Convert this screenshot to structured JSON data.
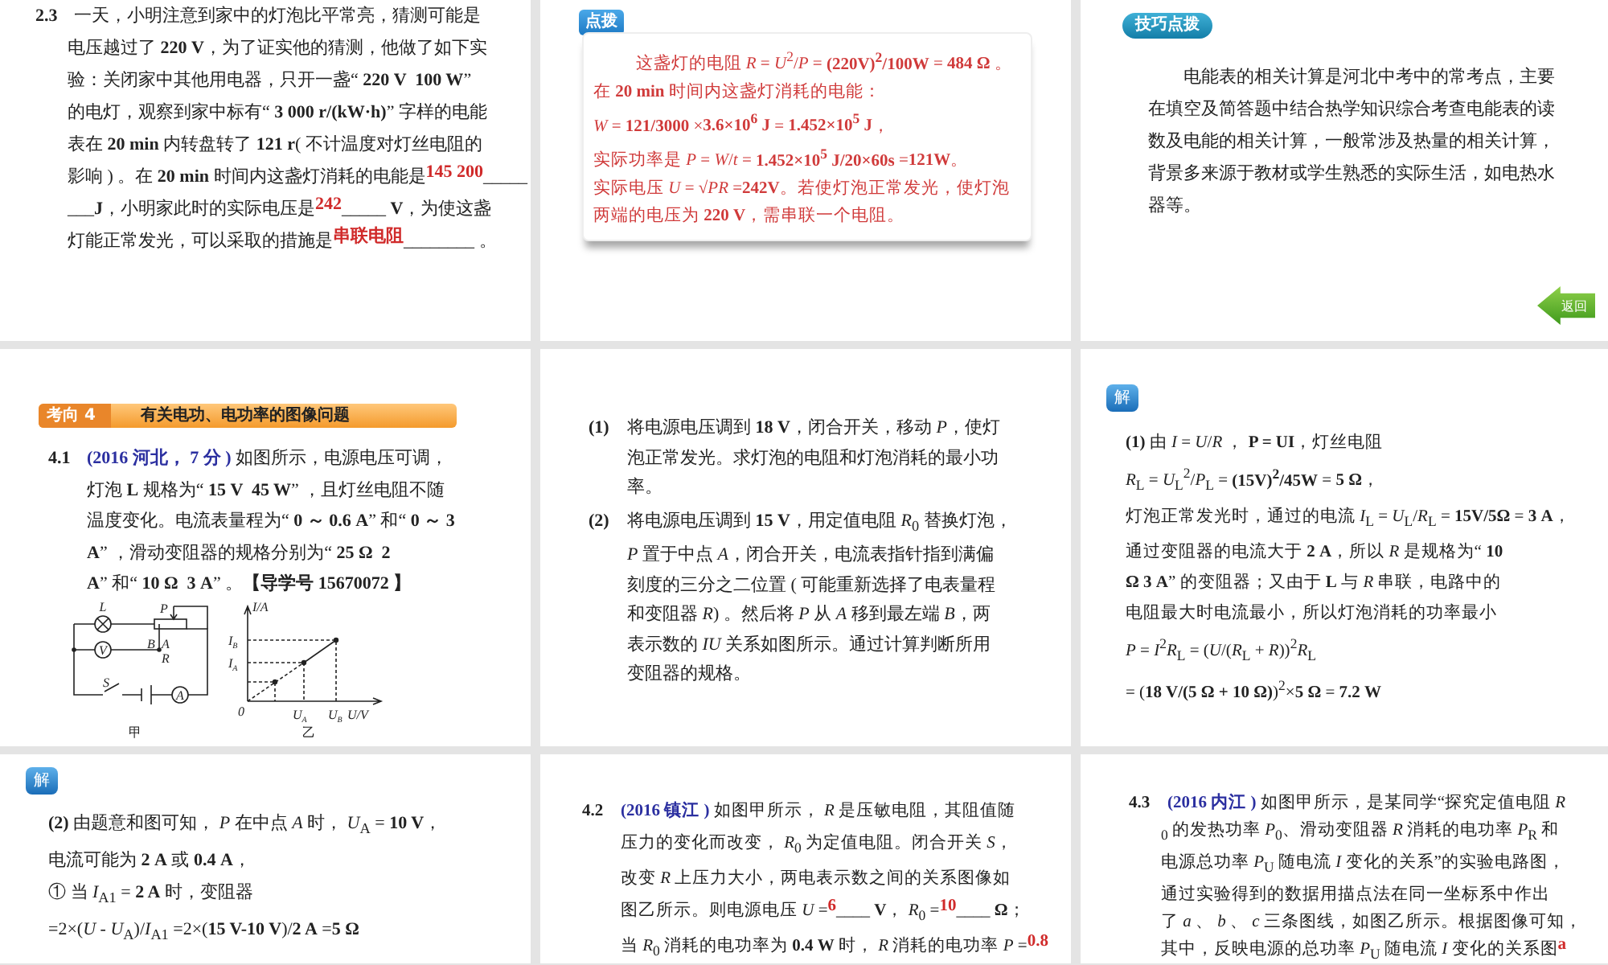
{
  "slides": [
    {
      "blocks": [
        {
          "kind": "question",
          "lines": [
            [
              {
                "kind": "number",
                "text": "2.3"
              },
              {
                "kind": "text",
                "text": "一天，小明注意到家中的灯泡比平常亮，猜测可能是"
              }
            ],
            [
              {
                "kind": "text",
                "text": "电压越过了 **220 V**，为了证实他的猜测，他做了如下实"
              }
            ],
            [
              {
                "kind": "text",
                "text": "验：关闭家中其他用电器，只开一盏“ **220 V  100 W**”"
              }
            ],
            [
              {
                "kind": "text",
                "text": "的电灯，观察到家中标有“ **3 000 r/(kW·h)**” 字样的电能"
              }
            ],
            [
              {
                "kind": "text",
                "text": "表在 **20 min** 内转盘转了 **121 r**( 不计温度对灯丝电阻的"
              }
            ],
            [
              {
                "kind": "text",
                "text": "影响 ) 。在 **20 min** 时间内这盏灯消耗的电能是"
              },
              {
                "kind": "answer",
                "text": "145 200"
              },
              {
                "kind": "text",
                "text": "_____"
              }
            ],
            [
              {
                "kind": "text",
                "text": "___**J**，小明家此时的实际电压是"
              },
              {
                "kind": "answer",
                "text": "242"
              },
              {
                "kind": "text",
                "text": "_____ **V**，为使这盏"
              }
            ],
            [
              {
                "kind": "text",
                "text": "灯能正常发光，可以采取的措施是"
              },
              {
                "kind": "answer",
                "text": "串联电阻"
              },
              {
                "kind": "text",
                "text": "________ 。"
              }
            ]
          ]
        }
      ]
    },
    {
      "badge": {
        "kind": "tab",
        "text": "点拨"
      },
      "blocks": [
        {
          "kind": "card",
          "lines": [
            "这盏灯的电阻 *R* = *U*$^{2}$/*P* = **(220V)$^{2}$/100W** = **484 Ω** 。在 **20 min** 时间内这盏灯消耗的电能：",
            "*W* = **121/3000** ×**3.6×10$^{6}$ J** = **1.452×10$^{5}$ J**，",
            "实际功率是 *P* = *W*/*t* = **1.452×10$^{5}$ J/20×60s** =**121W**。",
            "实际电压 *U* = √*PR* =**242V**。若使灯泡正常发光，使灯泡两端的电压为 **220 V**，需串联一个电阻。"
          ]
        }
      ]
    },
    {
      "badge": {
        "kind": "pill",
        "text": "技巧点拨"
      },
      "blocks": [
        {
          "kind": "para",
          "text": "电能表的相关计算是河北中考中的常考点，主要在填空及简答题中结合热学知识综合考查电能表的读数及电能的相关计算，一般常涉及热量的相关计算，背景多来源于教材或学生熟悉的实际生活，如电热水器等。"
        },
        {
          "kind": "back",
          "text": "返回"
        }
      ]
    },
    {
      "badge": {
        "kind": "section",
        "tag": "考向 4",
        "text": "有关电功、电功率的图像问题"
      },
      "blocks": [
        {
          "kind": "question",
          "lines": [
            [
              {
                "kind": "number",
                "text": "4.1"
              },
              {
                "kind": "source",
                "text": "(2016 河北， 7 分 )"
              },
              {
                "kind": "text",
                "text": " 如图所示，电源电压可调，"
              }
            ],
            [
              {
                "kind": "text",
                "text": "灯泡 **L** 规格为“ **15 V  45 W**” ，且灯丝电阻不随"
              }
            ],
            [
              {
                "kind": "text",
                "text": "温度变化。电流表量程为“ **0 ～ 0.6 A**” 和“ **0 ～ 3**"
              }
            ],
            [
              {
                "kind": "text",
                "text": "**A**” ，滑动变阻器的规格分别为“ **25 Ω  2**"
              }
            ],
            [
              {
                "kind": "text",
                "text": "**A**” 和“ **10 Ω  3 A**” 。**【导学号 15670072 】**"
              }
            ]
          ]
        },
        {
          "kind": "figures",
          "circuit": [
            "L",
            "P",
            "B",
            "A",
            "R",
            "V",
            "S",
            "A"
          ],
          "circuit_caption": "甲",
          "graph": [
            {
              "main": "I/A"
            },
            {
              "main": "I",
              "sub": "B"
            },
            {
              "main": "I",
              "sub": "A"
            },
            {
              "main": "0"
            },
            {
              "main": "U",
              "sub": "A"
            },
            {
              "main": "U",
              "sub": "B"
            },
            {
              "main": "U/V"
            }
          ],
          "graph_caption": "乙"
        }
      ]
    },
    {
      "blocks": [
        {
          "kind": "question",
          "lines": [
            [
              {
                "kind": "number",
                "text": "(1)"
              },
              {
                "kind": "text",
                "text": "将电源电压调到 **18 V**，闭合开关，移动 *P*，使灯"
              }
            ],
            [
              {
                "kind": "text",
                "text": "泡正常发光。求灯泡的电阻和灯泡消耗的最小功"
              }
            ],
            [
              {
                "kind": "text",
                "text": "率。"
              }
            ]
          ]
        },
        {
          "kind": "question",
          "lines": [
            [
              {
                "kind": "number",
                "text": "(2)"
              },
              {
                "kind": "text",
                "text": "将电源电压调到 **15 V**，用定值电阻 *R*$_{0}$ 替换灯泡，"
              }
            ],
            [
              {
                "kind": "text",
                "text": "*P* 置于中点 *A*，闭合开关，电流表指针指到满偏"
              }
            ],
            [
              {
                "kind": "text",
                "text": "刻度的三分之二位置 ( 可能重新选择了电表量程"
              }
            ],
            [
              {
                "kind": "text",
                "text": "和变阻器 *R*) 。然后将 *P* 从 *A* 移到最左端 *B*，两"
              }
            ],
            [
              {
                "kind": "text",
                "text": "表示数的 *IU* 关系如图所示。通过计算判断所用"
              }
            ],
            [
              {
                "kind": "text",
                "text": "变阻器的规格。"
              }
            ]
          ]
        }
      ]
    },
    {
      "badge": {
        "kind": "solve",
        "text": "解"
      },
      "blocks": [
        {
          "kind": "para",
          "text": "**(1)** 由 *I* = *U*/*R* ， **P = UI**，灯丝电阻"
        },
        {
          "kind": "para",
          "text": "*R*$_{L}$ = *U*$_{L}$$^{2}$/*P*$_{L}$ = **(15V)$^{2}$/45W** = **5 Ω**，"
        },
        {
          "kind": "para",
          "text": "灯泡正常发光时，通过的电流 *I*$_{L}$ = *U*$_{L}$/*R*$_{L}$ = **15V/5Ω** = **3 A**，"
        },
        {
          "kind": "para",
          "text": "通过变阻器的电流大于 **2 A**，所以 *R* 是规格为“ **10**"
        },
        {
          "kind": "para",
          "text": "**Ω  3 A**” 的变阻器；又由于 **L** 与 *R* 串联，电路中的"
        },
        {
          "kind": "para",
          "text": "电阻最大时电流最小，所以灯泡消耗的功率最小"
        },
        {
          "kind": "para",
          "text": "*P* = *I*$^{2}$*R*$_{L}$ = (*U*/(*R*$_{L}$ + *R*))$^{2}$*R*$_{L}$"
        },
        {
          "kind": "para",
          "text": "= (**18 V/(5 Ω + 10 Ω)**)$^{2}$×**5 Ω** = **7.2 W**"
        }
      ]
    },
    {
      "badge": {
        "kind": "solve",
        "text": "解"
      },
      "blocks": [
        {
          "kind": "para",
          "text": "**(2)** 由题意和图可知， *P* 在中点 *A* 时， *U*$_{A}$ = **10 V**，"
        },
        {
          "kind": "para",
          "text": "电流可能为 **2 A** 或 **0.4 A**，"
        },
        {
          "kind": "para",
          "text": "① 当 *I*$_{A1}$ = **2 A** 时，变阻器"
        },
        {
          "kind": "para",
          "text": "=2×(*U* - *U*$_{A}$)/*I*$_{A1}$ =2×(**15 V-10 V**)/**2 A** =**5 Ω**"
        }
      ]
    },
    {
      "blocks": [
        {
          "kind": "question",
          "lines": [
            [
              {
                "kind": "number",
                "text": "4.2"
              },
              {
                "kind": "source",
                "text": "(2016 镇江 )"
              },
              {
                "kind": "text",
                "text": " 如图甲所示， *R* 是压敏电阻，其阻值随"
              }
            ],
            [
              {
                "kind": "text",
                "text": "压力的变化而改变， *R*$_{0}$ 为定值电阻。闭合开关 *S*，"
              }
            ],
            [
              {
                "kind": "text",
                "text": "改变 *R* 上压力大小，两电表示数之间的关系图像如"
              }
            ],
            [
              {
                "kind": "text",
                "text": "图乙所示。则电源电压 *U* ="
              },
              {
                "kind": "answer",
                "text": "6"
              },
              {
                "kind": "text",
                "text": "____ **V**， *R*$_{0}$ ="
              },
              {
                "kind": "answer",
                "text": "10"
              },
              {
                "kind": "text",
                "text": "____ **Ω**；"
              }
            ],
            [
              {
                "kind": "text",
                "text": "当 *R*$_{0}$ 消耗的电功率为 **0.4 W** 时， *R* 消耗的电功率 *P* ="
              },
              {
                "kind": "answer",
                "text": "0.8"
              }
            ]
          ]
        }
      ]
    },
    {
      "blocks": [
        {
          "kind": "question",
          "lines": [
            [
              {
                "kind": "number",
                "text": "4.3"
              },
              {
                "kind": "source",
                "text": "(2016 内江 )"
              },
              {
                "kind": "text",
                "text": " 如图甲所示，是某同学“探究定值电阻 *R*"
              }
            ],
            [
              {
                "kind": "text",
                "text": "$_{0}$ 的发热功率 *P*$_{0}$、滑动变阻器 *R* 消耗的电功率 *P*$_{R}$ 和"
              }
            ],
            [
              {
                "kind": "text",
                "text": "电源总功率 *P*$_{U}$ 随电流 *I* 变化的关系”的实验电路图，"
              }
            ],
            [
              {
                "kind": "text",
                "text": "通过实验得到的数据用描点法在同一坐标系中作出"
              }
            ],
            [
              {
                "kind": "text",
                "text": "了 *a* 、 *b* 、 *c* 三条图线，如图乙所示。根据图像可知，"
              }
            ],
            [
              {
                "kind": "text",
                "text": "其中，反映电源的总功率 *P*$_{U}$ 随电流 *I* 变化的关系图"
              },
              {
                "kind": "answer",
                "text": "a"
              }
            ]
          ]
        }
      ]
    }
  ]
}
